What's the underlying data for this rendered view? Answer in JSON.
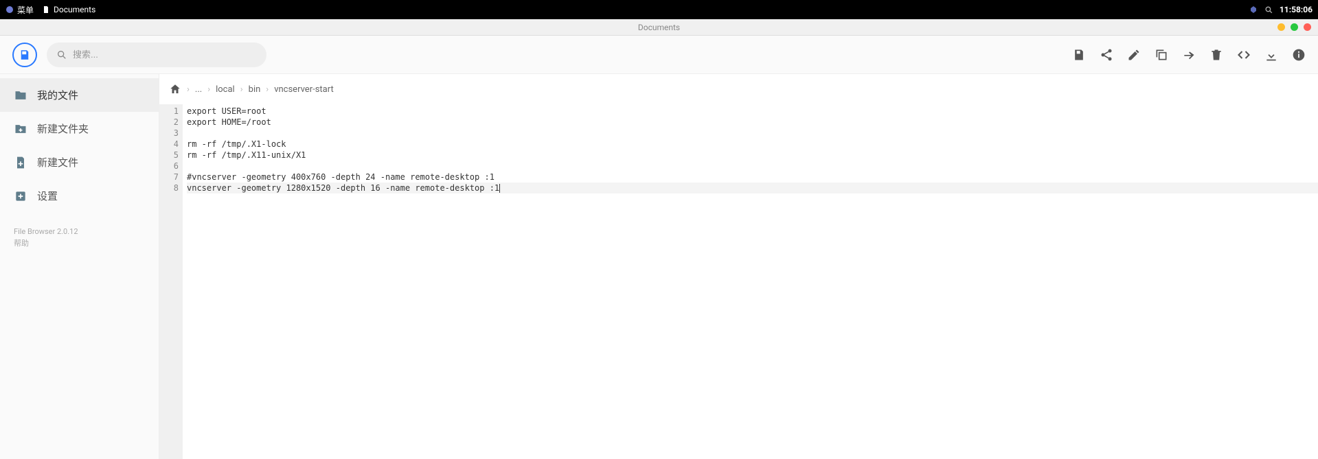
{
  "sysbar": {
    "menu_label": "菜单",
    "app_label": "Documents",
    "clock": "11:58:06"
  },
  "window": {
    "title": "Documents"
  },
  "search": {
    "placeholder": "搜索..."
  },
  "sidebar": {
    "items": [
      {
        "label": "我的文件",
        "icon": "folder-icon"
      },
      {
        "label": "新建文件夹",
        "icon": "folder-plus-icon"
      },
      {
        "label": "新建文件",
        "icon": "file-plus-icon"
      },
      {
        "label": "设置",
        "icon": "settings-icon"
      }
    ],
    "footer_version": "File Browser 2.0.12",
    "footer_help": "帮助"
  },
  "breadcrumb": {
    "ellipsis": "...",
    "parts": [
      "local",
      "bin",
      "vncserver-start"
    ]
  },
  "toolbar_icons": [
    "save-icon",
    "share-icon",
    "edit-icon",
    "copy-icon",
    "forward-icon",
    "delete-icon",
    "code-icon",
    "download-icon",
    "info-icon"
  ],
  "editor": {
    "lines": [
      "export USER=root",
      "export HOME=/root",
      "",
      "rm -rf /tmp/.X1-lock",
      "rm -rf /tmp/.X11-unix/X1",
      "",
      "#vncserver -geometry 400x760 -depth 24 -name remote-desktop :1",
      "vncserver -geometry 1280x1520 -depth 16 -name remote-desktop :1"
    ],
    "cursor_line": 8
  }
}
